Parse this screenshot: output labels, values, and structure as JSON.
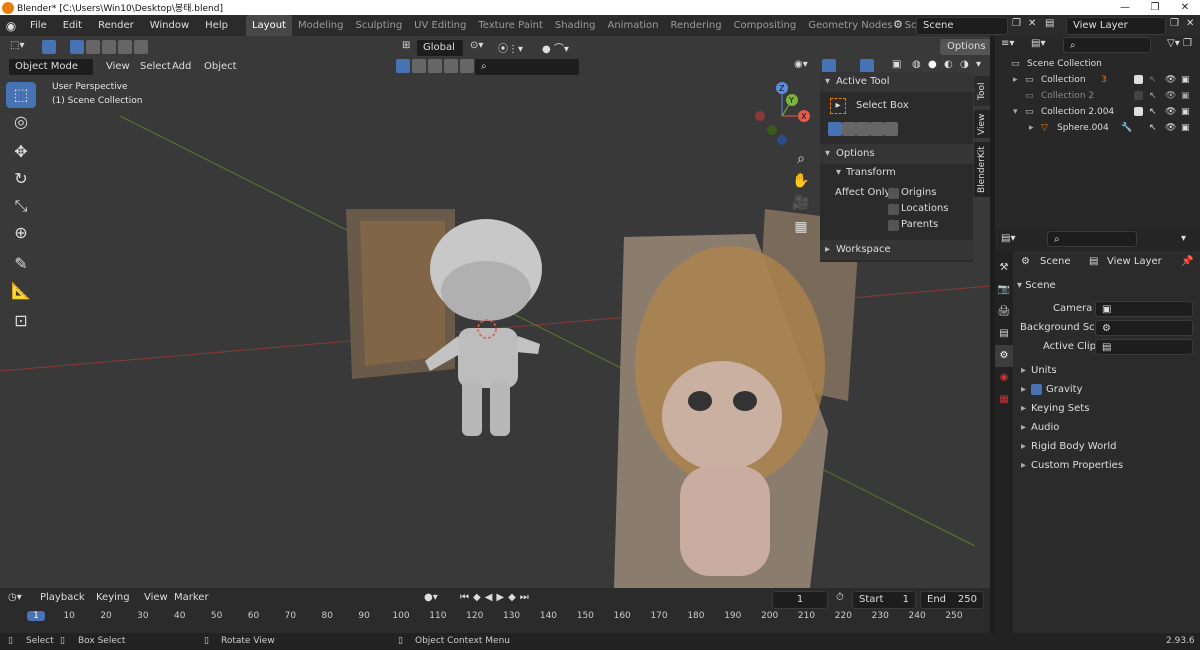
{
  "titlebar": {
    "title": "Blender* [C:\\Users\\Win10\\Desktop\\봉태.blend]",
    "minimize": "—",
    "maximize": "❐",
    "close": "✕"
  },
  "menu": {
    "file": "File",
    "edit": "Edit",
    "render": "Render",
    "window": "Window",
    "help": "Help"
  },
  "workspaces": [
    "Layout",
    "Modeling",
    "Sculpting",
    "UV Editing",
    "Texture Paint",
    "Shading",
    "Animation",
    "Rendering",
    "Compositing",
    "Geometry Nodes",
    "Scripting"
  ],
  "add_workspace": "+",
  "scene_field": "Scene",
  "view_layer_field": "View Layer",
  "viewport": {
    "transform_orientation": "Global",
    "options_btn": "Options",
    "mode": "Object Mode",
    "view_menu": "View",
    "select_menu": "Select",
    "add_menu": "Add",
    "object_menu": "Object",
    "overlay_line1": "User Perspective",
    "overlay_line2": "(1) Scene Collection",
    "gizmo": {
      "x": "X",
      "y": "Y",
      "z": "Z"
    }
  },
  "npanel": {
    "active_tool": "Active Tool",
    "select_box": "Select Box",
    "options": "Options",
    "transform": "Transform",
    "affect_only": "Affect Only",
    "origins": "Origins",
    "locations": "Locations",
    "parents": "Parents",
    "workspace": "Workspace",
    "tabs": [
      "Tool",
      "View",
      "BlenderKit"
    ]
  },
  "outliner": {
    "rows": [
      {
        "label": "Scene Collection"
      },
      {
        "label": "Collection",
        "badge": "3"
      },
      {
        "label": "Collection 2"
      },
      {
        "label": "Collection 2.004"
      },
      {
        "label": "Sphere.004"
      }
    ]
  },
  "properties": {
    "breadcrumb_scene": "Scene",
    "breadcrumb_layer": "View Layer",
    "section_scene": "Scene",
    "camera_label": "Camera",
    "bg_label": "Background Sc...",
    "clip_label": "Active Clip",
    "sections": [
      "Units",
      "Gravity",
      "Keying Sets",
      "Audio",
      "Rigid Body World",
      "Custom Properties"
    ],
    "gravity_checked": true
  },
  "timeline": {
    "playback": "Playback",
    "keying": "Keying",
    "view": "View",
    "marker": "Marker",
    "current_frame": "1",
    "start_label": "Start",
    "start_value": "1",
    "end_label": "End",
    "end_value": "250",
    "ticks": [
      "1",
      "10",
      "20",
      "30",
      "40",
      "50",
      "60",
      "70",
      "80",
      "90",
      "100",
      "110",
      "120",
      "130",
      "140",
      "150",
      "160",
      "170",
      "180",
      "190",
      "200",
      "210",
      "220",
      "230",
      "240",
      "250"
    ]
  },
  "statusbar": {
    "select": "Select",
    "box_select": "Box Select",
    "rotate_view": "Rotate View",
    "context_menu": "Object Context Menu",
    "version": "2.93.6"
  },
  "colors": {
    "accent": "#4772b3",
    "orange": "#e87d0d"
  }
}
